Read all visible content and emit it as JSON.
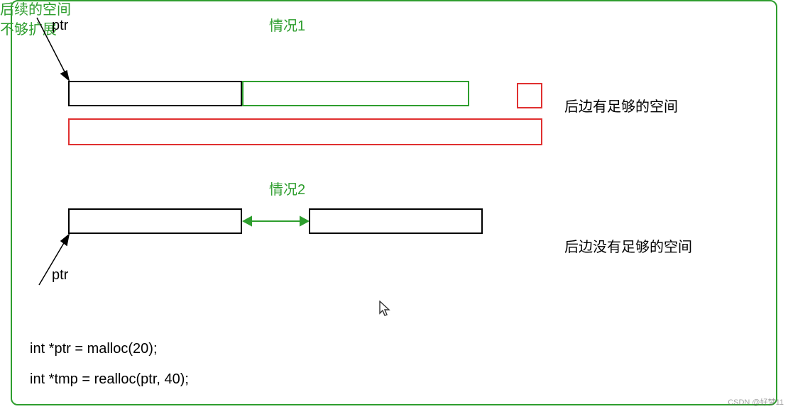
{
  "case1": {
    "ptr_label": "ptr",
    "title": "情况1",
    "right_label": "后边有足够的空间"
  },
  "case2": {
    "ptr_label": "ptr",
    "title": "情况2",
    "note": "后续的空间\n不够扩展",
    "right_label": "后边没有足够的空间"
  },
  "code": {
    "line1": "int *ptr = malloc(20);",
    "line2": "int *tmp = realloc(ptr, 40);"
  },
  "watermark": "CSDN @好梦11",
  "colors": {
    "green": "#2e9e2e",
    "red": "#e03030",
    "black": "#000000"
  }
}
